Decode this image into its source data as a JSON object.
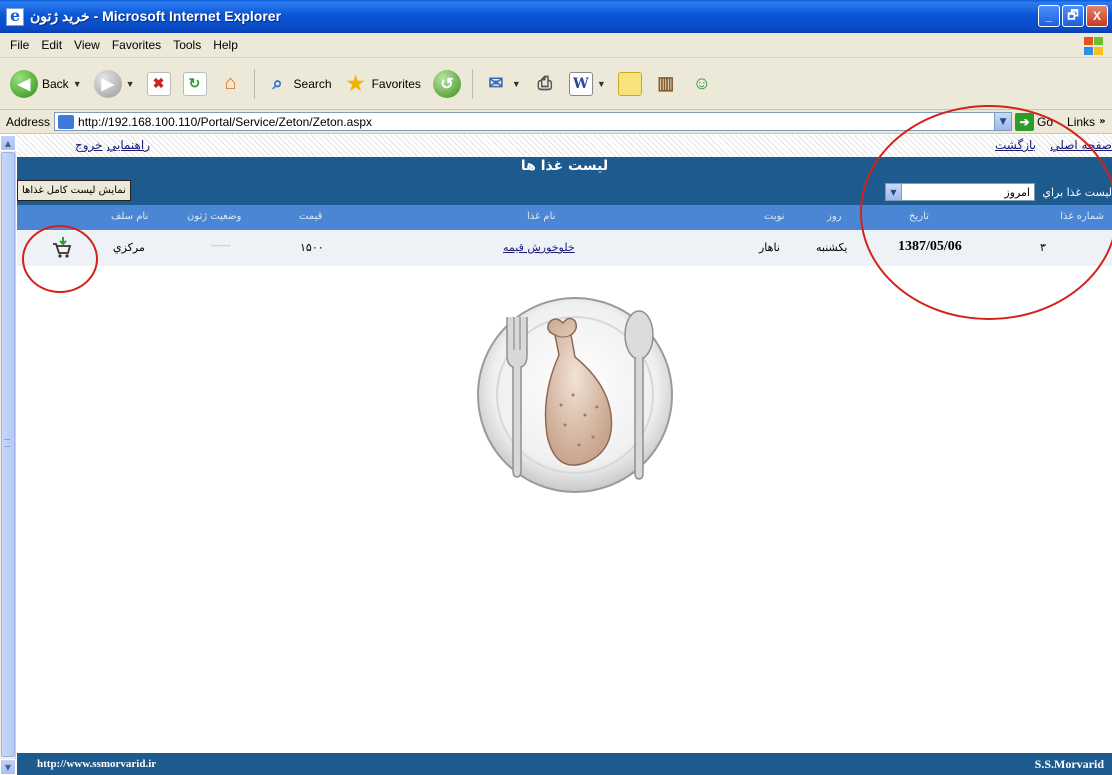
{
  "window": {
    "title": "خريد ژتون - Microsoft Internet Explorer",
    "minimize": "_",
    "maximize": "🗗",
    "close": "X"
  },
  "menu": [
    "File",
    "Edit",
    "View",
    "Favorites",
    "Tools",
    "Help"
  ],
  "toolbar": {
    "back": "Back",
    "search": "Search",
    "favorites": "Favorites"
  },
  "address": {
    "label": "Address",
    "url": "http://192.168.100.110/Portal/Service/Zeton/Zeton.aspx",
    "go": "Go",
    "links": "Links"
  },
  "page": {
    "links": {
      "back": "بازگشت",
      "home": "صفحه اصلي",
      "help": "راهنمايي",
      "exit": "خروج"
    },
    "list_title": "ليست غذا ها",
    "full_list_button": "نمايش ليست کامل غذاها",
    "for_label": "ليست غذا براي",
    "day_selected": "امروز",
    "columns": {
      "num": "شماره غذا",
      "date": "تاريخ",
      "day": "روز",
      "shift": "نوبت",
      "food": "نام غذا",
      "price": "قيمت",
      "ticket": "وضعيت ژتون",
      "hall": "نام سلف"
    },
    "row": {
      "num": "۳",
      "date": "1387/05/06",
      "day": "يکشنبه",
      "shift": "ناهار",
      "food": "خلوخورش قيمه",
      "price": "۱۵۰۰",
      "ticket": "------",
      "hall": "مرکزي"
    },
    "status_left": "http://www.ssmorvarid.ir",
    "status_right": "S.S.Morvarid"
  },
  "icons": {
    "cart": "shopping-cart-icon",
    "plate": "plate-chicken-image"
  },
  "colors": {
    "header_band": "#1d5a8e",
    "column_header": "#4a86d3",
    "annotation": "#d3221b"
  }
}
